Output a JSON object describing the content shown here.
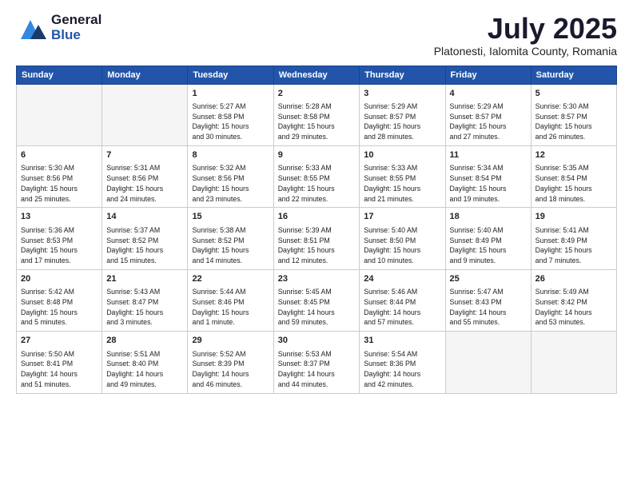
{
  "logo": {
    "line1": "General",
    "line2": "Blue"
  },
  "title": "July 2025",
  "subtitle": "Platonesti, Ialomita County, Romania",
  "headers": [
    "Sunday",
    "Monday",
    "Tuesday",
    "Wednesday",
    "Thursday",
    "Friday",
    "Saturday"
  ],
  "weeks": [
    [
      {
        "day": "",
        "info": ""
      },
      {
        "day": "",
        "info": ""
      },
      {
        "day": "1",
        "info": "Sunrise: 5:27 AM\nSunset: 8:58 PM\nDaylight: 15 hours\nand 30 minutes."
      },
      {
        "day": "2",
        "info": "Sunrise: 5:28 AM\nSunset: 8:58 PM\nDaylight: 15 hours\nand 29 minutes."
      },
      {
        "day": "3",
        "info": "Sunrise: 5:29 AM\nSunset: 8:57 PM\nDaylight: 15 hours\nand 28 minutes."
      },
      {
        "day": "4",
        "info": "Sunrise: 5:29 AM\nSunset: 8:57 PM\nDaylight: 15 hours\nand 27 minutes."
      },
      {
        "day": "5",
        "info": "Sunrise: 5:30 AM\nSunset: 8:57 PM\nDaylight: 15 hours\nand 26 minutes."
      }
    ],
    [
      {
        "day": "6",
        "info": "Sunrise: 5:30 AM\nSunset: 8:56 PM\nDaylight: 15 hours\nand 25 minutes."
      },
      {
        "day": "7",
        "info": "Sunrise: 5:31 AM\nSunset: 8:56 PM\nDaylight: 15 hours\nand 24 minutes."
      },
      {
        "day": "8",
        "info": "Sunrise: 5:32 AM\nSunset: 8:56 PM\nDaylight: 15 hours\nand 23 minutes."
      },
      {
        "day": "9",
        "info": "Sunrise: 5:33 AM\nSunset: 8:55 PM\nDaylight: 15 hours\nand 22 minutes."
      },
      {
        "day": "10",
        "info": "Sunrise: 5:33 AM\nSunset: 8:55 PM\nDaylight: 15 hours\nand 21 minutes."
      },
      {
        "day": "11",
        "info": "Sunrise: 5:34 AM\nSunset: 8:54 PM\nDaylight: 15 hours\nand 19 minutes."
      },
      {
        "day": "12",
        "info": "Sunrise: 5:35 AM\nSunset: 8:54 PM\nDaylight: 15 hours\nand 18 minutes."
      }
    ],
    [
      {
        "day": "13",
        "info": "Sunrise: 5:36 AM\nSunset: 8:53 PM\nDaylight: 15 hours\nand 17 minutes."
      },
      {
        "day": "14",
        "info": "Sunrise: 5:37 AM\nSunset: 8:52 PM\nDaylight: 15 hours\nand 15 minutes."
      },
      {
        "day": "15",
        "info": "Sunrise: 5:38 AM\nSunset: 8:52 PM\nDaylight: 15 hours\nand 14 minutes."
      },
      {
        "day": "16",
        "info": "Sunrise: 5:39 AM\nSunset: 8:51 PM\nDaylight: 15 hours\nand 12 minutes."
      },
      {
        "day": "17",
        "info": "Sunrise: 5:40 AM\nSunset: 8:50 PM\nDaylight: 15 hours\nand 10 minutes."
      },
      {
        "day": "18",
        "info": "Sunrise: 5:40 AM\nSunset: 8:49 PM\nDaylight: 15 hours\nand 9 minutes."
      },
      {
        "day": "19",
        "info": "Sunrise: 5:41 AM\nSunset: 8:49 PM\nDaylight: 15 hours\nand 7 minutes."
      }
    ],
    [
      {
        "day": "20",
        "info": "Sunrise: 5:42 AM\nSunset: 8:48 PM\nDaylight: 15 hours\nand 5 minutes."
      },
      {
        "day": "21",
        "info": "Sunrise: 5:43 AM\nSunset: 8:47 PM\nDaylight: 15 hours\nand 3 minutes."
      },
      {
        "day": "22",
        "info": "Sunrise: 5:44 AM\nSunset: 8:46 PM\nDaylight: 15 hours\nand 1 minute."
      },
      {
        "day": "23",
        "info": "Sunrise: 5:45 AM\nSunset: 8:45 PM\nDaylight: 14 hours\nand 59 minutes."
      },
      {
        "day": "24",
        "info": "Sunrise: 5:46 AM\nSunset: 8:44 PM\nDaylight: 14 hours\nand 57 minutes."
      },
      {
        "day": "25",
        "info": "Sunrise: 5:47 AM\nSunset: 8:43 PM\nDaylight: 14 hours\nand 55 minutes."
      },
      {
        "day": "26",
        "info": "Sunrise: 5:49 AM\nSunset: 8:42 PM\nDaylight: 14 hours\nand 53 minutes."
      }
    ],
    [
      {
        "day": "27",
        "info": "Sunrise: 5:50 AM\nSunset: 8:41 PM\nDaylight: 14 hours\nand 51 minutes."
      },
      {
        "day": "28",
        "info": "Sunrise: 5:51 AM\nSunset: 8:40 PM\nDaylight: 14 hours\nand 49 minutes."
      },
      {
        "day": "29",
        "info": "Sunrise: 5:52 AM\nSunset: 8:39 PM\nDaylight: 14 hours\nand 46 minutes."
      },
      {
        "day": "30",
        "info": "Sunrise: 5:53 AM\nSunset: 8:37 PM\nDaylight: 14 hours\nand 44 minutes."
      },
      {
        "day": "31",
        "info": "Sunrise: 5:54 AM\nSunset: 8:36 PM\nDaylight: 14 hours\nand 42 minutes."
      },
      {
        "day": "",
        "info": ""
      },
      {
        "day": "",
        "info": ""
      }
    ]
  ]
}
